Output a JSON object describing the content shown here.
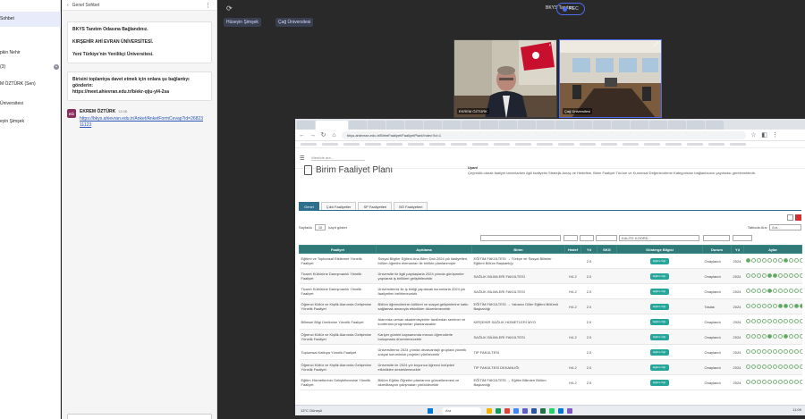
{
  "left_nav": {
    "items": [
      "Sohbet",
      "pkin Nehir",
      "(3)",
      "M ÖZTÜRK (Sen)",
      "Üniversitesi",
      "eyin Şimşek"
    ]
  },
  "chat": {
    "header": "Genel Sohbet",
    "system_message": {
      "line1": "BKYS Tanıtım Odasına Bağlandınız.",
      "line2": "KIRŞEHİR AHİ EVRAN ÜNİVERSİTESİ.",
      "line3": "Yeni Türkiye'nin Yenilikçi Üniversitesi."
    },
    "invite_message": {
      "text": "Birisini toplantıya davet etmek için onlara şu bağlantıyı gönderin:",
      "link": "https://meet.ahievran.edu.tr/b/ekr-qiju-yl4-2sa"
    },
    "message": {
      "avatar": "EÖ",
      "sender": "EKREM ÖZTÜRK",
      "time": "11:08",
      "link": "https://bkys.ahievran.edu.tr/Anket/AnketFormCevap?id=2682311123"
    }
  },
  "meeting": {
    "title": "BKYS Tanıtım",
    "record_label": "REC",
    "participants": [
      "Hüseyin Şimşek",
      "Çağ Üniversitesi"
    ],
    "videos": [
      {
        "label": "EKREM ÖZTÜRK"
      },
      {
        "label": "Çağ Üniversitesi"
      }
    ]
  },
  "browser": {
    "url": "bkys.ahievran.edu.tr/BirimFaaliyet/FaaliyetPlani/Index?id=1",
    "app": {
      "search_placeholder": "Menüde ara...",
      "page_title": "Birim Faaliyet Planı",
      "info_title": "Uyarı!",
      "info_text": "Çeyreklik olarak faaliyet tanımlarken ilgili faaliyetin Stratejik Amaç ve Hedefine, Birim Faaliyet Türüne ve Kurumsal Değerlendirme Kategorisine bağlantısının yapılması gerekmektedir.",
      "tabs": [
        "Genel",
        "Çıktı Faaliyetler",
        "SP Faaliyetleri",
        "BÖ Faaliyetleri"
      ],
      "length_prefix": "Sayfada",
      "length_value": "10",
      "length_suffix": "kayıt göster",
      "search_label": "Tabloda Ara:",
      "search_value": "Ara...",
      "filter_birim": "KALİTE KOORD.",
      "columns": [
        "Faaliyet",
        "Açıklama",
        "Birim",
        "Hedef",
        "Yıl",
        "SKG",
        "Gösterge Bilgisi",
        "Durum",
        "Yıl",
        "Aylar"
      ],
      "rows": [
        {
          "faaliyet": "Eğitimi ve Toplumsal Etkilerine Yönelik Faaliyet",
          "aciklama": "Sosyal Bilgiler Eğitimi Ana Bilim Dalı 2024 yılı faaliyetleri, bölüm öğretim elemanları ile birlikte planlanmıştır",
          "birim": "EĞİTİM FAKÜLTESİ → Türkçe ve Sosyal Bilimler Eğitimi Bölüm Başkanlığı",
          "hedef": "",
          "yil": "2.0",
          "skg": "",
          "badge": "Eğitim Öğr.",
          "durum": "Onaylandı",
          "yil2": "2024",
          "months": [
            1,
            0,
            0,
            0,
            0,
            0,
            0,
            1,
            0,
            0,
            0,
            0
          ]
        },
        {
          "faaliyet": "Ticaret Kültürüne Danışmanlık Yönelik Faaliyet",
          "aciklama": "Üniversite ile ilgili paydaşlarla 2024 yılında görüşmeler yapılarak iş birlikleri geliştirilecektir",
          "birim": "SAĞLIK BİLİMLERİ FAKÜLTESİ",
          "hedef": "H4.2",
          "yil": "2.0",
          "skg": "",
          "badge": "Eğitim Öğr.",
          "durum": "Onaylandı",
          "yil2": "2024",
          "months": [
            0,
            0,
            0,
            0,
            1,
            1,
            0,
            0,
            0,
            0,
            0,
            0
          ]
        },
        {
          "faaliyet": "Ticaret Kültürüne Danışmanlık Yönelik Faaliyet",
          "aciklama": "Üniversitemiz ile iş birliği yapılacak kurumlarla 2024 yılı faaliyetleri belirlenecektir",
          "birim": "SAĞLIK BİLİMLERİ FAKÜLTESİ",
          "hedef": "H4.2",
          "yil": "2.0",
          "skg": "",
          "badge": "Eğitim Öğr.",
          "durum": "Onaylandı",
          "yil2": "2024",
          "months": [
            0,
            0,
            0,
            0,
            1,
            0,
            0,
            0,
            0,
            0,
            0,
            0
          ]
        },
        {
          "faaliyet": "Öğrenci Kültür ve Kişilik Alanında Gelişimine Yönelik Faaliyet",
          "aciklama": "Bölüm öğrencilerinin kültürel ve sosyal gelişimlerine katkı sağlamak amacıyla etkinlikler düzenlenecektir",
          "birim": "EĞİTİM FAKÜLTESİ → Yabancı Diller Eğitimi Bölümü Başkanlığı",
          "hedef": "H4.2",
          "yil": "2.0",
          "skg": "",
          "badge": "Eğitim Öğr.",
          "durum": "Taslak",
          "yil2": "2024",
          "months": [
            0,
            0,
            0,
            0,
            0,
            0,
            1,
            1,
            0,
            1,
            1,
            0
          ]
        },
        {
          "faaliyet": "Bilimsel Bilgi Üretimine Yönelik Faaliyet",
          "aciklama": "Alanında uzman akademisyenler tarafından seminer ve konferans programları planlanacaktır",
          "birim": "KIRŞEHİR SAĞLIK HİZMETLERİ MYO",
          "hedef": "",
          "yil": "2.0",
          "skg": "",
          "badge": "Eğitim Öğr.",
          "durum": "Onaylandı",
          "yil2": "2024",
          "months": [
            0,
            0,
            0,
            0,
            0,
            0,
            0,
            0,
            0,
            0,
            0,
            0
          ]
        },
        {
          "faaliyet": "Öğrenci Kültür ve Kişilik Alanında Gelişimine Yönelik Faaliyet",
          "aciklama": "Kariyer günleri kapsamında mezun öğrencilerle buluşmalar düzenlenecektir",
          "birim": "SAĞLIK BİLİMLERİ FAKÜLTESİ",
          "hedef": "H4.2",
          "yil": "2.0",
          "skg": "",
          "badge": "Eğitim Öğr.",
          "durum": "Onaylandı",
          "yil2": "2024",
          "months": [
            0,
            0,
            0,
            0,
            1,
            0,
            0,
            1,
            0,
            0,
            0,
            0
          ]
        },
        {
          "faaliyet": "Toplumsal Katkıya Yönelik Faaliyet",
          "aciklama": "Üniversitemiz 2024 yılında dezavantajlı gruplara yönelik sosyal sorumluluk projeleri yürütecektir",
          "birim": "TIP FAKÜLTESİ",
          "hedef": "",
          "yil": "2.0",
          "skg": "",
          "badge": "Eğitim Öğr.",
          "durum": "Onaylandı",
          "yil2": "2024",
          "months": [
            0,
            0,
            0,
            0,
            0,
            0,
            0,
            0,
            0,
            0,
            0,
            0
          ]
        },
        {
          "faaliyet": "Öğrenci Kültür ve Kişilik Alanında Gelişimine Yönelik Faaliyet",
          "aciklama": "Üniversite ile 2024 yılı boyunca öğrenci kulüpleri etkinlikleri desteklenecektir",
          "birim": "TIP FAKÜLTESİ DEKANLIĞI",
          "hedef": "H4.2",
          "yil": "2.0",
          "skg": "",
          "badge": "Eğitim Öğr.",
          "durum": "Onaylandı",
          "yil2": "2024",
          "months": [
            0,
            0,
            0,
            0,
            0,
            0,
            0,
            0,
            0,
            0,
            0,
            0
          ]
        },
        {
          "faaliyet": "Eğitim Hizmetlerinin Geliştirilmesine Yönelik Faaliyet",
          "aciklama": "Bölüm Eğitim Öğretim planlarının güncellenmesi ve akreditasyon çalışmaları yürütülecektir",
          "birim": "EĞİTİM FAKÜLTESİ → Eğitim Bilimleri Bölüm Başkanlığı",
          "hedef": "H4.2",
          "yil": "2.0",
          "skg": "",
          "badge": "Eğitim Öğr.",
          "durum": "Onaylandı",
          "yil2": "2024",
          "months": [
            0,
            0,
            0,
            0,
            0,
            0,
            0,
            0,
            0,
            0,
            0,
            0
          ]
        }
      ]
    },
    "taskbar": {
      "weather": "13°C Güneşli",
      "search": "Ara",
      "clock": "11:09"
    }
  },
  "colors": {
    "teal_header": "#2f7a79",
    "badge": "#26a69a",
    "accent": "#4f6bed"
  }
}
